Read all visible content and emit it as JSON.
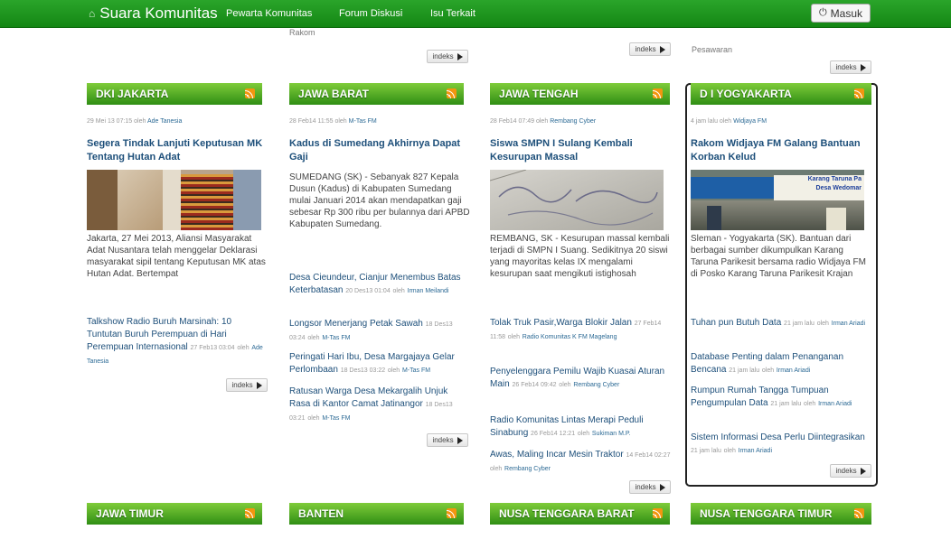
{
  "nav": {
    "brand": "Suara Komunitas",
    "links": [
      "Pewarta Komunitas",
      "Forum Diskusi",
      "Isu Terkait"
    ],
    "login": "Masuk"
  },
  "top_clipped": {
    "col1": "Rakom",
    "col4": "Pesawaran"
  },
  "indeks_label": "indeks",
  "columns": [
    {
      "title": "DKI JAKARTA",
      "meta_time": "29 Mei 13 07:15 oleh",
      "meta_by": "Ade Tanesia",
      "headline": "Segera Tindak Lanjuti Keputusan MK Tentang Hutan Adat",
      "body": "Jakarta, 27 Mei 2013, Aliansi Masyarakat Adat Nusantara telah menggelar Deklarasi masyarakat sipil tentang Keputusan MK atas Hutan Adat. Bertempat",
      "links": [
        {
          "title": "Talkshow Radio Buruh Marsinah: 10 Tuntutan Buruh Perempuan di Hari Perempuan Internasional",
          "date": "27 Feb13 03:04",
          "oleh": "oleh",
          "by": "Ade Tanesia"
        }
      ]
    },
    {
      "title": "JAWA BARAT",
      "meta_time": "28 Feb14 11:55 oleh",
      "meta_by": "M-Tas FM",
      "headline": "Kadus di Sumedang Akhirnya Dapat Gaji",
      "body": "SUMEDANG (SK) - Sebanyak 827 Kepala Dusun (Kadus) di Kabupaten Sumedang mulai Januari 2014 akan mendapatkan gaji sebesar Rp 300 ribu per bulannya dari APBD Kabupaten Sumedang.",
      "links": [
        {
          "title": "Desa Cieundeur, Cianjur Menembus Batas Keterbatasan",
          "date": "20 Des13 01:04",
          "oleh": "oleh",
          "by": "Irman Meilandi"
        },
        {
          "title": "Longsor Menerjang Petak Sawah",
          "date": "18 Des13 03:24",
          "oleh": "oleh",
          "by": "M-Tas FM"
        },
        {
          "title": "Peringati Hari Ibu, Desa Margajaya Gelar Perlombaan",
          "date": "18 Des13 03:22",
          "oleh": "oleh",
          "by": "M-Tas FM"
        },
        {
          "title": "Ratusan Warga Desa Mekargalih Unjuk Rasa di Kantor Camat Jatinangor",
          "date": "18 Des13 03:21",
          "oleh": "oleh",
          "by": "M-Tas FM"
        }
      ]
    },
    {
      "title": "JAWA TENGAH",
      "meta_time": "28 Feb14 07:49 oleh",
      "meta_by": "Rembang Cyber",
      "headline": "Siswa SMPN I Sulang Kembali Kesurupan Massal",
      "body": "REMBANG, SK - Kesurupan massal kembali terjadi di SMPN I Suang. Sedikitnya 20 siswi yang mayoritas kelas IX mengalami kesurupan saat mengikuti istighosah",
      "links": [
        {
          "title": "Tolak Truk Pasir,Warga Blokir Jalan",
          "date": "27 Feb14 11:58",
          "oleh": "oleh",
          "by": "Radio Komunitas K FM Magelang"
        },
        {
          "title": "Penyelenggara Pemilu Wajib Kuasai Aturan Main",
          "date": "26 Feb14 09:42",
          "oleh": "oleh",
          "by": "Rembang Cyber"
        },
        {
          "title": "Radio Komunitas Lintas Merapi Peduli Sinabung",
          "date": "26 Feb14 12:21",
          "oleh": "oleh",
          "by": "Sukiman M.P."
        },
        {
          "title": "Awas, Maling Incar Mesin Traktor",
          "date": "14 Feb14 02:27",
          "oleh": "oleh",
          "by": "Rembang Cyber"
        }
      ]
    },
    {
      "title": "D I YOGYAKARTA",
      "meta_time": "4 jam lalu oleh",
      "meta_by": "Widjaya FM",
      "headline": "Rakom Widjaya FM Galang Bantuan Korban Kelud",
      "body": "Sleman - Yogyakarta (SK). Bantuan dari berbagai sumber dikumpulkan Karang Taruna Parikesit bersama radio Widjaya FM di Posko Karang Taruna Parikesit Krajan",
      "links": [
        {
          "title": "Tuhan pun Butuh Data",
          "date": "21 jam lalu",
          "oleh": "oleh",
          "by": "Irman Ariadi"
        },
        {
          "title": "Database Penting dalam Penanganan Bencana",
          "date": "21 jam lalu",
          "oleh": "oleh",
          "by": "Irman Ariadi"
        },
        {
          "title": "Rumpun Rumah Tangga Tumpuan Pengumpulan Data",
          "date": "21 jam lalu",
          "oleh": "oleh",
          "by": "Irman Ariadi"
        },
        {
          "title": "Sistem Informasi Desa Perlu Diintegrasikan",
          "date": "21 jam lalu",
          "oleh": "oleh",
          "by": "Irman Ariadi"
        }
      ]
    }
  ],
  "photo_text": {
    "banner1": "Karang Taruna Pa",
    "banner2": "Desa Wedomar"
  },
  "bottom_headers": [
    "JAWA TIMUR",
    "BANTEN",
    "NUSA TENGGARA BARAT",
    "NUSA TENGGARA TIMUR"
  ],
  "colors": {
    "nav_green": "#1a9a1a",
    "header_green": "#4aa620",
    "link_blue": "#1d4f7a",
    "rss_orange": "#f2960f"
  }
}
